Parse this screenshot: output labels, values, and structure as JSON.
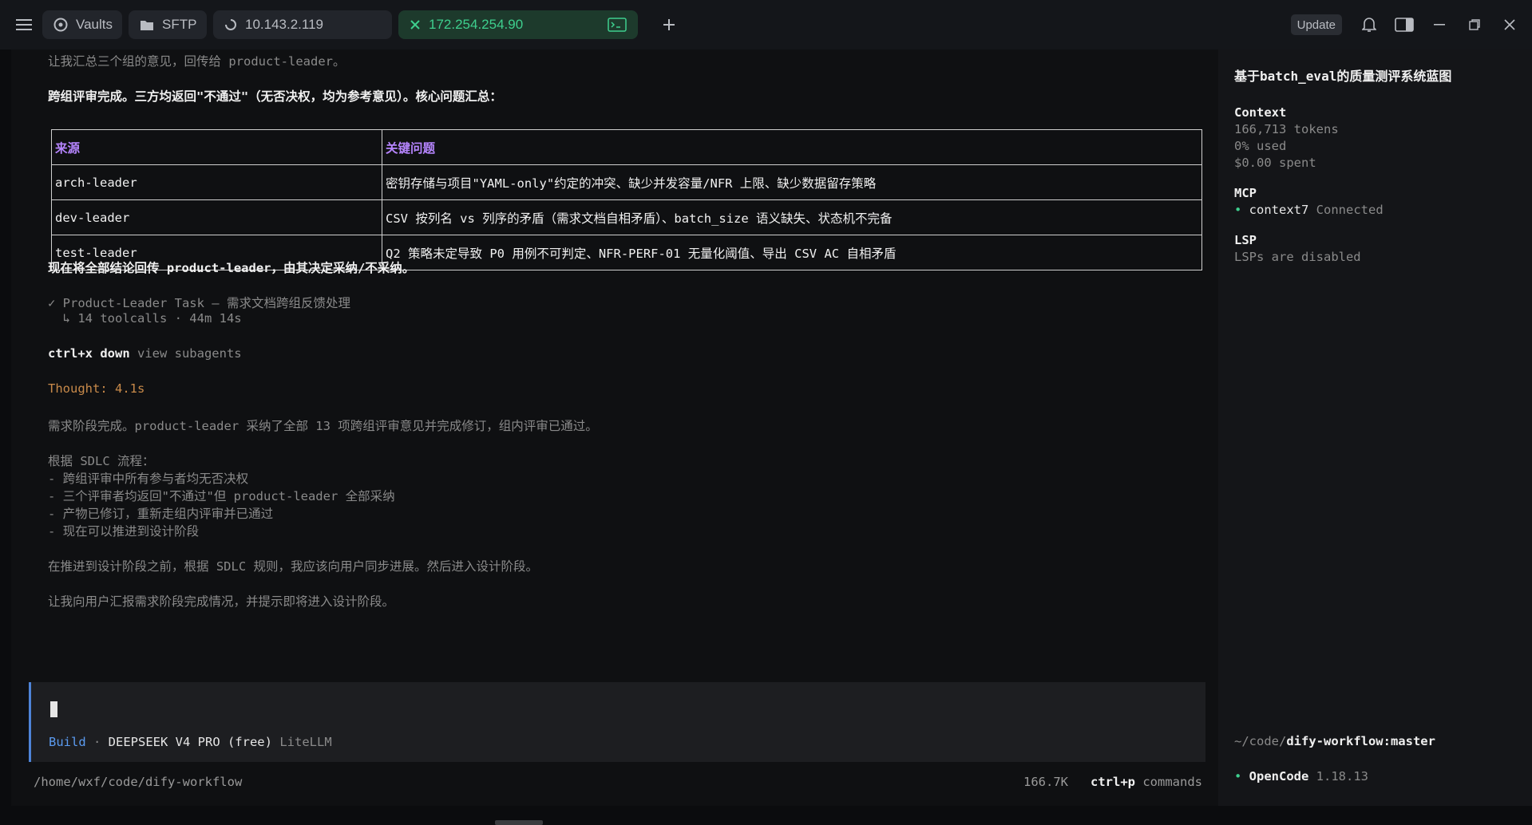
{
  "tabs": {
    "vaults": "Vaults",
    "sftp": "SFTP",
    "host1": "10.143.2.119",
    "host2": "172.254.254.90"
  },
  "topbar": {
    "update": "Update"
  },
  "chat": {
    "line1": "让我汇总三个组的意见，回传给 product-leader。",
    "line2": "跨组评审完成。三方均返回\"不通过\"（无否决权，均为参考意见）。核心问题汇总：",
    "table": {
      "headers": [
        "来源",
        "关键问题"
      ],
      "rows": [
        [
          "arch-leader",
          "密钥存储与项目\"YAML-only\"约定的冲突、缺少并发容量/NFR 上限、缺少数据留存策略"
        ],
        [
          "dev-leader",
          "CSV 按列名 vs 列序的矛盾（需求文档自相矛盾）、batch_size 语义缺失、状态机不完备"
        ],
        [
          "test-leader",
          "Q2 策略未定导致 P0 用例不可判定、NFR-PERF-01 无量化阈值、导出 CSV AC 自相矛盾"
        ]
      ]
    },
    "line3": "现在将全部结论回传 product-leader，由其决定采纳/不采纳。",
    "task": "✓ Product-Leader Task — 需求文档跨组反馈处理",
    "task_sub": "  ↳ 14 toolcalls · 44m 14s",
    "shortcut_key": "ctrl+x down",
    "shortcut_desc": " view subagents",
    "thought": "Thought: 4.1s",
    "p1": "需求阶段完成。product-leader 采纳了全部 13 项跨组评审意见并完成修订，组内评审已通过。",
    "p2_title": "根据 SDLC 流程：",
    "p2_items": [
      "- 跨组评审中所有参与者均无否决权",
      "- 三个评审者均返回\"不通过\"但 product-leader 全部采纳",
      "- 产物已修订，重新走组内评审并已通过",
      "- 现在可以推进到设计阶段"
    ],
    "p3": "在推进到设计阶段之前，根据 SDLC 规则，我应该向用户同步进展。然后进入设计阶段。",
    "p4": "让我向用户汇报需求阶段完成情况，并提示即将进入设计阶段。"
  },
  "input": {
    "mode": "Build",
    "model": "DEEPSEEK V4 PRO (free)",
    "provider": "LiteLLM"
  },
  "status": {
    "path": "/home/wxf/code/dify-workflow",
    "tokens": "166.7K",
    "cmd_key": "ctrl+p",
    "cmd_label": "commands"
  },
  "sidebar": {
    "title": "基于batch_eval的质量测评系统蓝图",
    "context_h": "Context",
    "context_tokens": "166,713 tokens",
    "context_used": "0% used",
    "context_spent": "$0.00 spent",
    "mcp_h": "MCP",
    "mcp_name": "context7",
    "mcp_status": "Connected",
    "lsp_h": "LSP",
    "lsp_status": "LSPs are disabled",
    "branch_prefix": "~/code/",
    "branch_name": "dify-workflow:master",
    "app_name": "OpenCode",
    "app_version": "1.18.13"
  }
}
